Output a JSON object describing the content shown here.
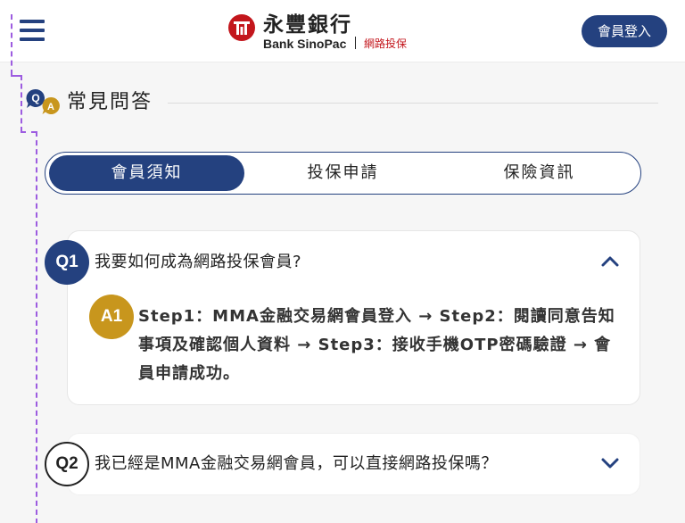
{
  "header": {
    "bank_name_cn": "永豐銀行",
    "bank_name_en": "Bank SinoPac",
    "sub_brand": "網路投保",
    "login_label": "會員登入"
  },
  "section": {
    "title": "常見問答",
    "qa_badge_q": "Q",
    "qa_badge_a": "A"
  },
  "tabs": [
    {
      "label": "會員須知",
      "active": true
    },
    {
      "label": "投保申請",
      "active": false
    },
    {
      "label": "保險資訊",
      "active": false
    }
  ],
  "faqs": [
    {
      "q_label": "Q1",
      "question": "我要如何成為網路投保會員?",
      "expanded": true,
      "a_label": "A1",
      "answer": "Step1：MMA金融交易網會員登入 → Step2：閱讀同意告知事項及確認個人資料 → Step3：接收手機OTP密碼驗證 → 會員申請成功。"
    },
    {
      "q_label": "Q2",
      "question": "我已經是MMA金融交易網會員，可以直接網路投保嗎？",
      "expanded": false
    }
  ],
  "colors": {
    "primary": "#24417f",
    "brand_red": "#c3161c",
    "answer_gold": "#c8961d",
    "dashed_line": "#9d5ce0"
  },
  "icons": {
    "menu": "hamburger-icon",
    "logo": "sinopac-logo-icon",
    "qa": "qa-bubble-icon",
    "collapse": "chevron-up-icon",
    "expand": "chevron-down-icon"
  }
}
